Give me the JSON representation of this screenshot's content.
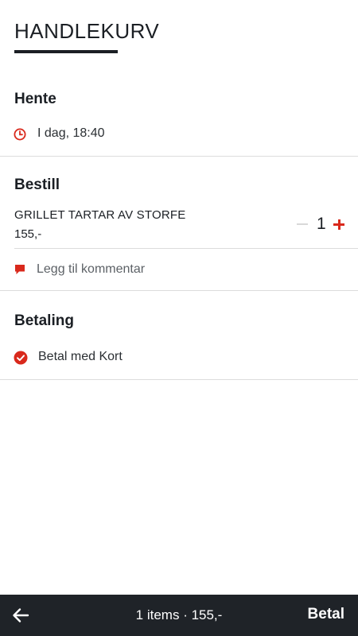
{
  "header": {
    "title": "HANDLEKURV"
  },
  "pickup": {
    "heading": "Hente",
    "time": "I dag, 18:40",
    "icon": "clock-icon"
  },
  "order": {
    "heading": "Bestill",
    "items": [
      {
        "name": "GRILLET TARTAR AV STORFE",
        "price": "155,-",
        "quantity": "1"
      }
    ],
    "comment_label": "Legg til kommentar",
    "comment_icon": "comment-icon"
  },
  "payment": {
    "heading": "Betaling",
    "method": "Betal med Kort",
    "icon": "check-circle-icon"
  },
  "footer": {
    "summary": "1 items · 155,-",
    "pay_label": "Betal",
    "back_icon": "arrow-left-icon"
  },
  "colors": {
    "accent": "#d9291c",
    "text": "#1b1f24",
    "bar": "#1f2328",
    "divider": "#dcdcdc"
  }
}
